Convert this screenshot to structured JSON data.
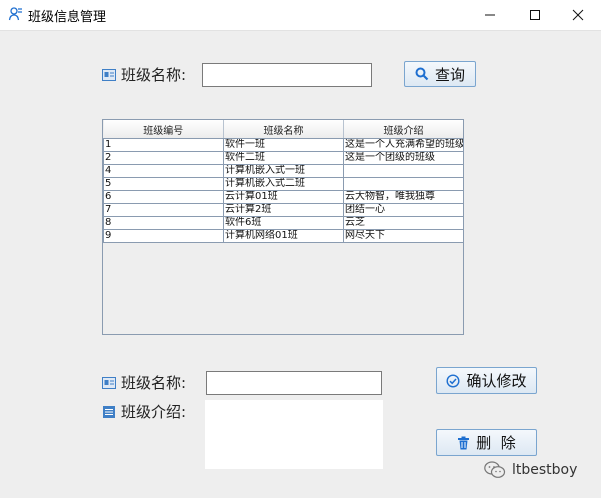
{
  "window": {
    "title": "班级信息管理",
    "minimize_glyph": "minimize",
    "maximize_glyph": "maximize",
    "close_glyph": "close"
  },
  "search": {
    "label": "班级名称:",
    "value": "",
    "button_label": "查询"
  },
  "table": {
    "columns": [
      "班级编号",
      "班级名称",
      "班级介绍"
    ],
    "rows": [
      [
        "1",
        "软件一班",
        "这是一个人充满希望的班级"
      ],
      [
        "2",
        "软件二班",
        "这是一个团级的班级"
      ],
      [
        "4",
        "计算机嵌入式一班",
        ""
      ],
      [
        "5",
        "计算机嵌入式二班",
        ""
      ],
      [
        "6",
        "云计算01班",
        "云大物智，唯我独尊"
      ],
      [
        "7",
        "云计算2班",
        "团结一心"
      ],
      [
        "8",
        "软件6班",
        "云芝"
      ],
      [
        "9",
        "计算机网络01班",
        "网尽天下"
      ]
    ]
  },
  "edit": {
    "name_label": "班级名称:",
    "name_value": "",
    "intro_label": "班级介绍:",
    "intro_value": "",
    "confirm_label": "确认修改",
    "delete_label": "删  除"
  },
  "watermark": {
    "text": "ltbestboy"
  },
  "colors": {
    "accent": "#1e6fd0",
    "button_border": "#7aa5cf",
    "table_border": "#8a9bb0"
  }
}
